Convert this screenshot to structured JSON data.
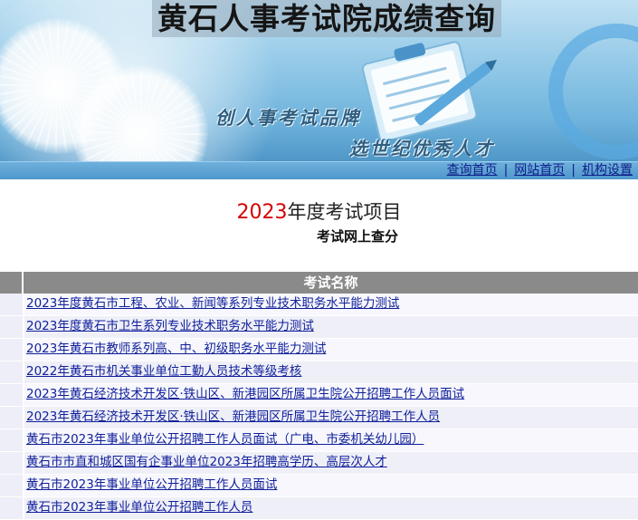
{
  "banner": {
    "title": "黄石人事考试院成绩查询",
    "slogan_line1": "创人事考试品牌",
    "slogan_line2": "选世纪优秀人才"
  },
  "nav": {
    "links": [
      "查询首页",
      "网站首页",
      "机构设置"
    ],
    "separator": "|"
  },
  "heading": {
    "year": "2023",
    "title_rest": "年度考试项目",
    "subtitle": "考试网上查分"
  },
  "table": {
    "header": "考试名称",
    "rows": [
      "2023年度黄石市工程、农业、新闻等系列专业技术职务水平能力测试",
      "2023年度黄石市卫生系列专业技术职务水平能力测试",
      "2023年黄石市教师系列高、中、初级职务水平能力测试",
      "2022年黄石市机关事业单位工勤人员技术等级考核",
      "2023年黄石经济技术开发区·铁山区、新港园区所属卫生院公开招聘工作人员面试",
      "2023年黄石经济技术开发区·铁山区、新港园区所属卫生院公开招聘工作人员",
      "黄石市2023年事业单位公开招聘工作人员面试（广电、市委机关幼儿园）",
      "黄石市市直和城区国有企事业单位2023年招聘高学历、高层次人才",
      "黄石市2023年事业单位公开招聘工作人员面试",
      "黄石市2023年事业单位公开招聘工作人员"
    ]
  },
  "colors": {
    "link": "#10209a",
    "year_highlight": "#d40000",
    "table_header_bg": "#8a8a8a",
    "banner_blue": "#6fb3dc"
  },
  "icons": [
    "dandelion-image",
    "clipboard-pencil-image",
    "circle-decoration"
  ]
}
